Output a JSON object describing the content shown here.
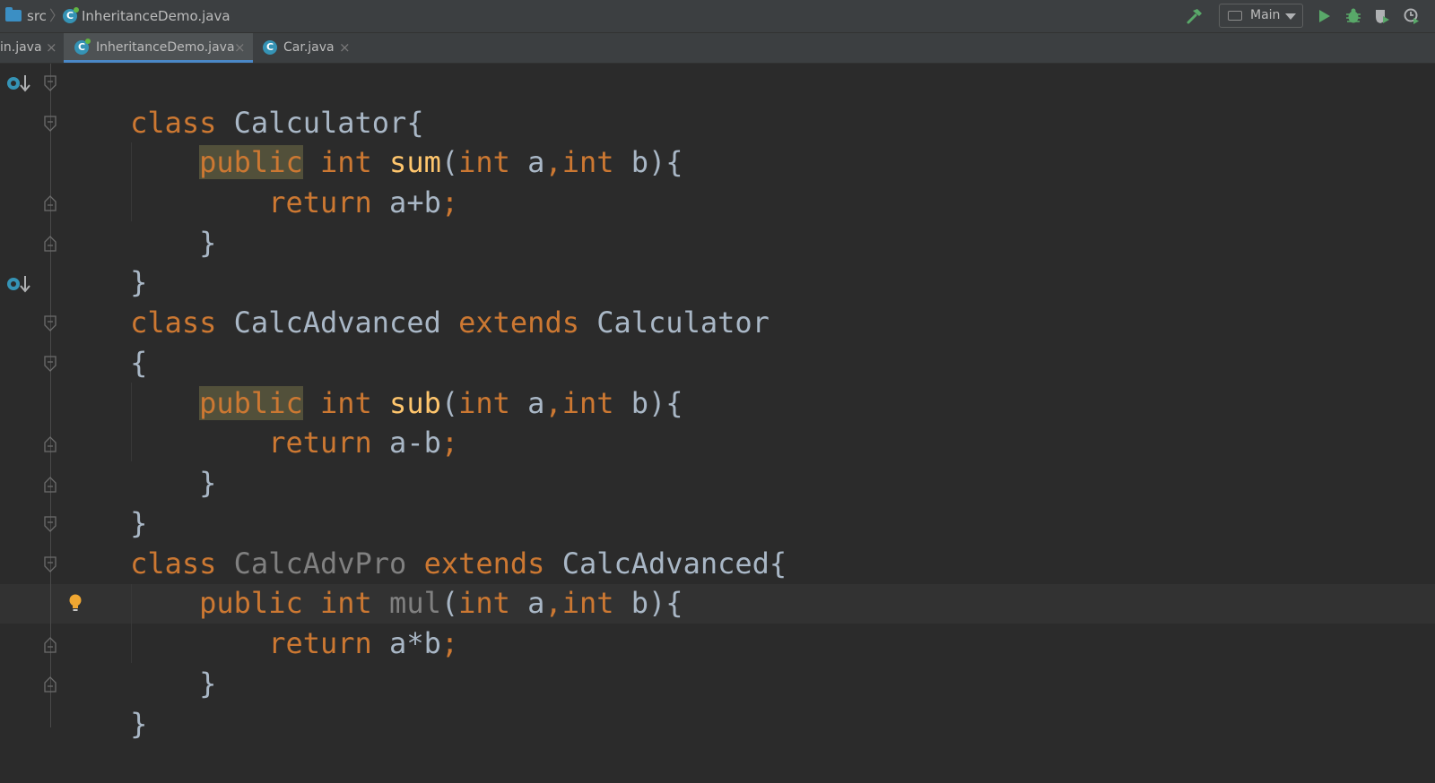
{
  "navbar": {
    "breadcrumb": [
      "src",
      "InheritanceDemo.java"
    ],
    "run_config": "Main",
    "icons": [
      "build-hammer-icon",
      "run-icon",
      "debug-icon",
      "coverage-icon",
      "profile-icon"
    ]
  },
  "tabs": [
    {
      "label": "in.java",
      "active": false
    },
    {
      "label": "InheritanceDemo.java",
      "active": true
    },
    {
      "label": "Car.java",
      "active": false
    }
  ],
  "code_lines": [
    "class Calculator{",
    "    public int sum(int a,int b){",
    "        return a+b;",
    "    }",
    "}",
    "class CalcAdvanced extends Calculator",
    "{",
    "    public int sub(int a,int b){",
    "        return a-b;",
    "    }",
    "}",
    "class CalcAdvPro extends CalcAdvanced{",
    "    public int mul(int a,int b){",
    "        return a*b;",
    "    }",
    "}"
  ],
  "colors": {
    "editor_bg": "#2b2b2b",
    "keyword": "#cc7832",
    "identifier": "#a9b7c6",
    "method": "#ffc66d",
    "unused": "#808080",
    "accent": "#4a88c7"
  }
}
